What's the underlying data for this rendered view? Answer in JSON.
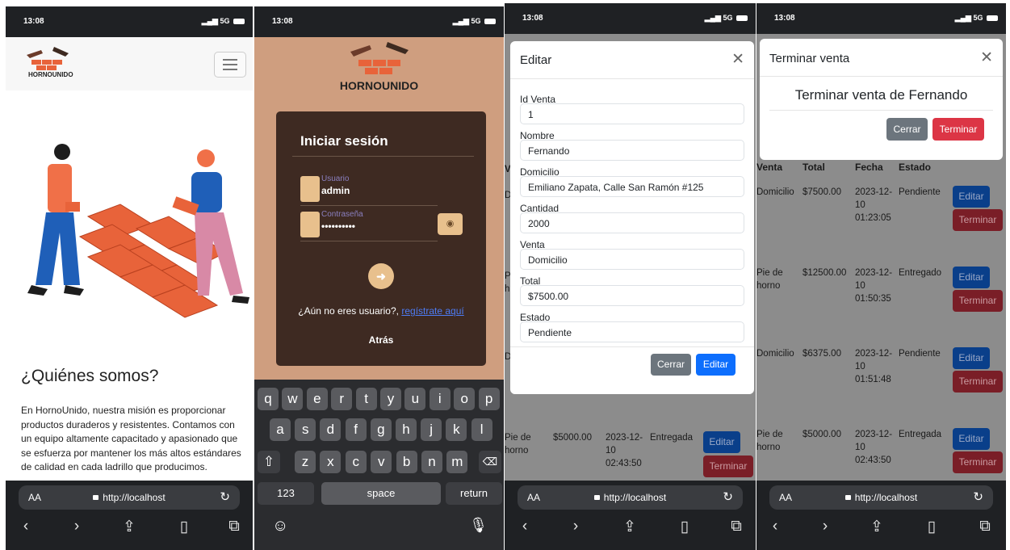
{
  "status": {
    "time": "13:08",
    "signal": "5G"
  },
  "browser": {
    "aa": "AA",
    "url": "http://localhost"
  },
  "screen1": {
    "brand": "HORNOUNIDO",
    "about_title": "¿Quiénes somos?",
    "about_text": "En HornoUnido, nuestra misión es proporcionar productos duraderos y resistentes. Contamos con un equipo altamente capacitado y apasionado que se esfuerza por mantener los más altos estándares de calidad en cada ladrillo que producimos."
  },
  "screen2": {
    "brand": "HORNOUNIDO",
    "title": "Iniciar sesión",
    "user_label": "Usuario",
    "user_value": "admin",
    "pass_label": "Contraseña",
    "pass_value": "••••••••••",
    "register_prompt": "¿Aún no eres usuario?,",
    "register_link": "regístrate aquí",
    "back": "Atrás",
    "keys_row1": [
      "q",
      "w",
      "e",
      "r",
      "t",
      "y",
      "u",
      "i",
      "o",
      "p"
    ],
    "keys_row2": [
      "a",
      "s",
      "d",
      "f",
      "g",
      "h",
      "j",
      "k",
      "l"
    ],
    "keys_row3": [
      "z",
      "x",
      "c",
      "v",
      "b",
      "n",
      "m"
    ],
    "key_shift": "⇧",
    "key_delete": "⌫",
    "key_123": "123",
    "key_space": "space",
    "key_return": "return"
  },
  "screen3": {
    "modal_title": "Editar",
    "fields": [
      {
        "label": "Id Venta",
        "value": "1"
      },
      {
        "label": "Nombre",
        "value": "Fernando"
      },
      {
        "label": "Domicilio",
        "value": "Emiliano Zapata, Calle San Ramón #125"
      },
      {
        "label": "Cantidad",
        "value": "2000"
      },
      {
        "label": "Venta",
        "value": "Domicilio"
      },
      {
        "label": "Total",
        "value": "$7500.00"
      },
      {
        "label": "Estado",
        "value": "Pendiente"
      }
    ],
    "close_btn": "Cerrar",
    "edit_btn": "Editar",
    "bg_row": {
      "venta": "Pie de horno",
      "total": "$5000.00",
      "fecha": "2023-12-10 02:43:50",
      "estado": "Entregada",
      "edit": "Editar",
      "finish": "Terminar"
    },
    "bg_partial": [
      "V",
      "D",
      "P",
      "h",
      "D"
    ]
  },
  "screen4": {
    "modal_title": "Terminar venta",
    "modal_body": "Terminar venta de Fernando",
    "close_btn": "Cerrar",
    "finish_btn": "Terminar",
    "headers": [
      "Venta",
      "Total",
      "Fecha",
      "Estado"
    ],
    "rows": [
      {
        "venta": "Domicilio",
        "total": "$7500.00",
        "fecha": "2023-12-10 01:23:05",
        "estado": "Pendiente"
      },
      {
        "venta": "Pie de horno",
        "total": "$12500.00",
        "fecha": "2023-12-10 01:50:35",
        "estado": "Entregado"
      },
      {
        "venta": "Domicilio",
        "total": "$6375.00",
        "fecha": "2023-12-10 01:51:48",
        "estado": "Pendiente"
      },
      {
        "venta": "Pie de horno",
        "total": "$5000.00",
        "fecha": "2023-12-10 02:43:50",
        "estado": "Entregada"
      }
    ],
    "edit_btn": "Editar",
    "row_finish_btn": "Terminar"
  },
  "colors": {
    "login_bg": "#cf9e7f",
    "card_bg": "#3e2a22",
    "accent": "#e8c08d",
    "primary": "#0d6efd",
    "danger": "#dc3545",
    "secondary": "#6c757d"
  }
}
